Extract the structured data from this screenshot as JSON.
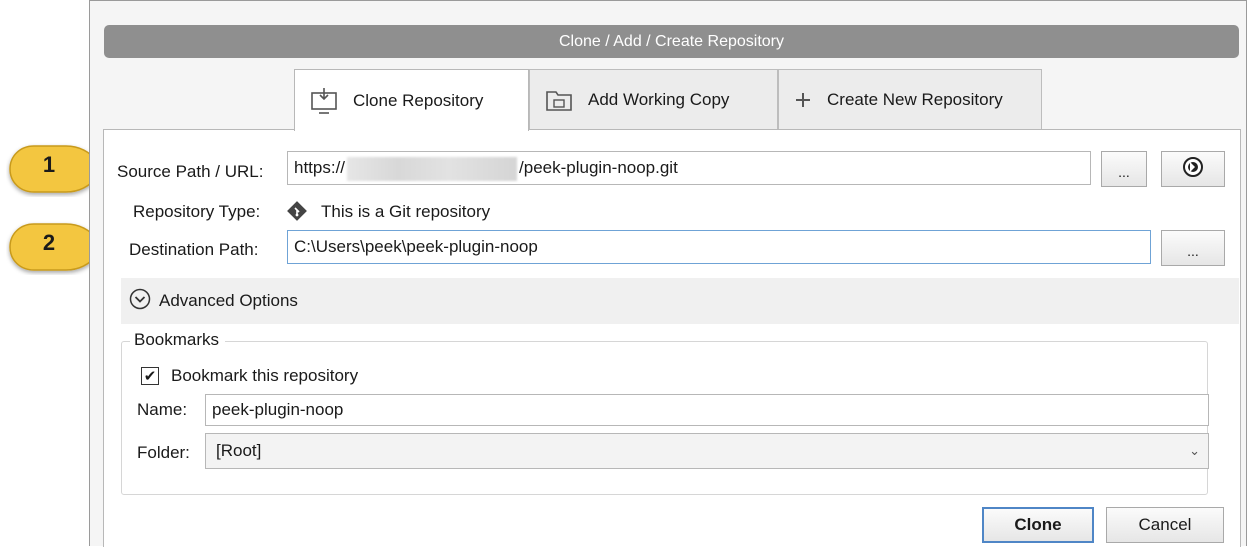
{
  "dialog": {
    "title": "Clone  / Add / Create Repository"
  },
  "tabs": [
    {
      "label": "Clone Repository",
      "icon": "clone-icon"
    },
    {
      "label": "Add Working Copy",
      "icon": "folder-icon"
    },
    {
      "label": "Create New Repository",
      "icon": "plus-icon"
    }
  ],
  "form": {
    "source_label": "Source Path / URL:",
    "source_prefix": "https://",
    "source_suffix": "/peek-plugin-noop.git",
    "repo_type_label": "Repository Type:",
    "repo_type_value": "This is a Git repository",
    "destination_label": "Destination Path:",
    "destination_value": "C:\\Users\\peek\\peek-plugin-noop",
    "browse_label": "...",
    "advanced_label": "Advanced Options"
  },
  "bookmarks": {
    "legend": "Bookmarks",
    "checkbox_label": "Bookmark this repository",
    "checked": true,
    "check_mark": "✔",
    "name_label": "Name:",
    "name_value": "peek-plugin-noop",
    "folder_label": "Folder:",
    "folder_value": "[Root]",
    "dropdown_glyph": "⌄"
  },
  "actions": {
    "clone_label": "Clone",
    "cancel_label": "Cancel"
  },
  "callouts": [
    "1",
    "2"
  ],
  "colors": {
    "callout": "#f3c640",
    "accent": "#4f86c6",
    "titlebar": "#8f8f8f"
  }
}
